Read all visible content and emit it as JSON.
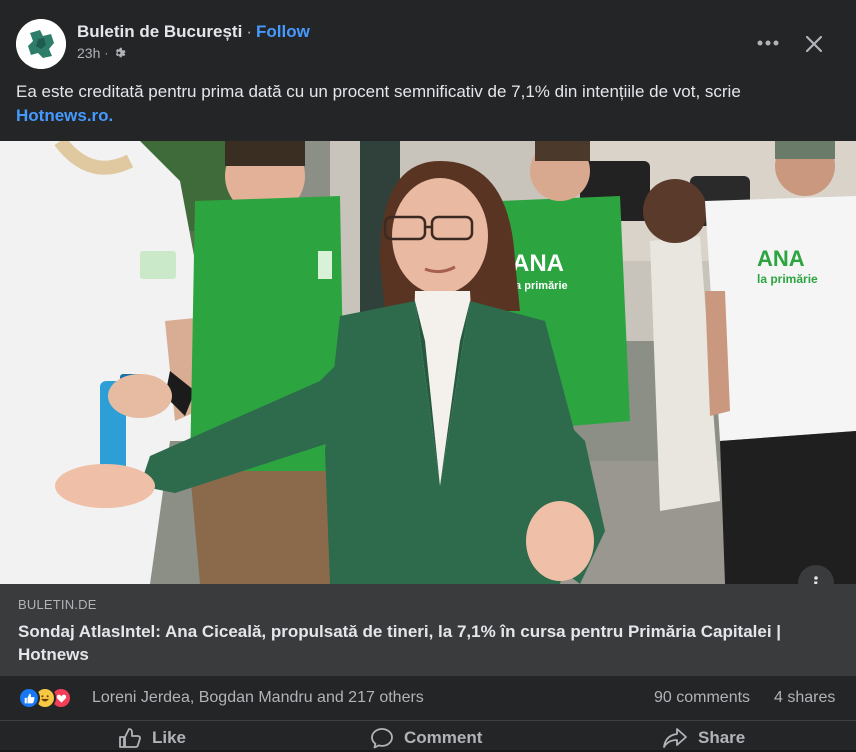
{
  "header": {
    "page_name": "Buletin de București",
    "separator": "·",
    "follow_label": "Follow",
    "time": "23h",
    "audience_icon": "gear-icon",
    "more_icon": "more-dots-icon",
    "close_icon": "close-icon"
  },
  "post": {
    "text": "Ea este creditată pentru prima dată cu un procent semnificativ de 7,1% din intențiile de vot, scrie",
    "link_text": "Hotnews.ro."
  },
  "photo": {
    "shirt_text_1": "ANA",
    "shirt_text_2": "la primărie",
    "shirt_text_3": "ANA",
    "shirt_text_4": "la primărie",
    "info_icon": "info-icon"
  },
  "link_preview": {
    "domain": "BULETIN.DE",
    "title": "Sondaj AtlasIntel: Ana Ciceală, propulsată de tineri, la 7,1% în cursa pentru Primăria Capitalei | Hotnews"
  },
  "reactions": {
    "names": "Loreni Jerdea, Bogdan Mandru and 217 others",
    "comments": "90 comments",
    "shares": "4 shares",
    "icons": [
      "like-reaction-icon",
      "haha-reaction-icon",
      "love-reaction-icon"
    ]
  },
  "actions": {
    "like": "Like",
    "comment": "Comment",
    "share": "Share"
  },
  "colors": {
    "background": "#242526",
    "link_blue": "#4599ff",
    "card_bg": "#3a3b3c",
    "jacket_green": "#2e6b4c",
    "shirt_green": "#2ca541"
  }
}
